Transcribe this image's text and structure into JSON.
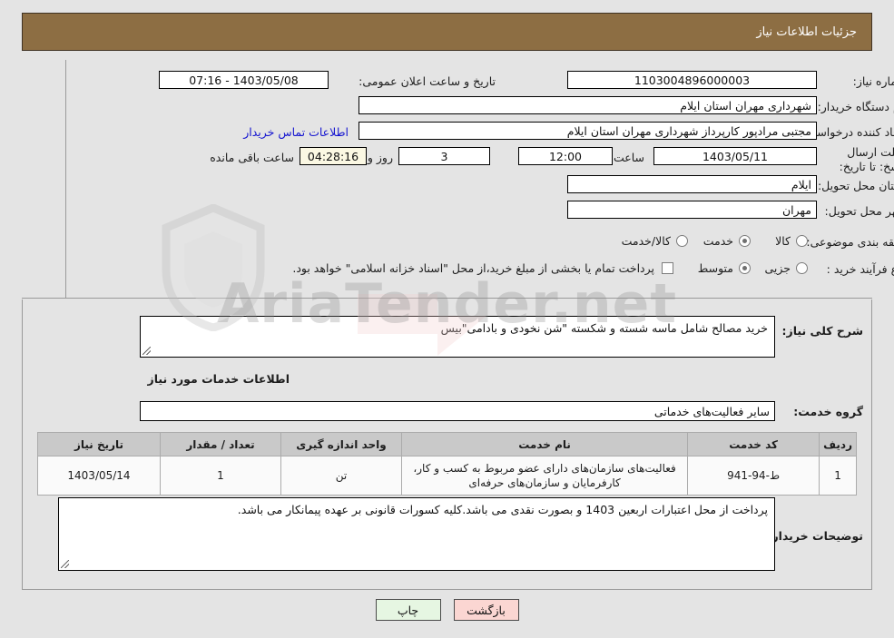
{
  "header": {
    "title": "جزئیات اطلاعات نیاز"
  },
  "watermark": {
    "text": "AriaTender.net"
  },
  "fields": {
    "need_number_label": "شماره نیاز:",
    "need_number_value": "1103004896000003",
    "buyer_org_label": "نام دستگاه خریدار:",
    "buyer_org_value": "شهرداری مهران استان ایلام",
    "creator_label": "ایجاد کننده درخواست:",
    "creator_value": "مجتبی مرادپور کارپرداز شهرداری مهران استان ایلام",
    "deadline_label": "مهلت ارسال پاسخ: تا تاریخ:",
    "deadline_date": "1403/05/11",
    "hour_label": "ساعت",
    "hour_value": "12:00",
    "days_value": "3",
    "days_label": "روز و",
    "countdown_value": "04:28:16",
    "countdown_label": "ساعت باقی مانده",
    "announce_label": "تاریخ و ساعت اعلان عمومی:",
    "announce_value": "1403/05/08 - 07:16",
    "buyer_contact_link": "اطلاعات تماس خریدار",
    "province_label": "استان محل تحویل:",
    "province_value": "ایلام",
    "city_label": "شهر محل تحویل:",
    "city_value": "مهران",
    "category_label": "طبقه بندی موضوعی:",
    "category_options": [
      "کالا",
      "خدمت",
      "کالا/خدمت"
    ],
    "category_selected": "خدمت",
    "process_label": "نوع فرآیند خرید :",
    "process_options": [
      "جزیی",
      "متوسط"
    ],
    "process_selected": "متوسط",
    "treasury_note": "پرداخت تمام یا بخشی از مبلغ خرید،از محل \"اسناد خزانه اسلامی\" خواهد بود.",
    "summary_label": "شرح کلی نیاز:",
    "summary_value": "خرید مصالح شامل ماسه شسته و شکسته \"شن نخودی و بادامی\"بیس",
    "services_heading": "اطلاعات خدمات مورد نیاز",
    "service_group_label": "گروه خدمت:",
    "service_group_value": "سایر فعالیت‌های خدماتی",
    "buyer_notes_label": "توضیحات خریدار:",
    "buyer_notes_value": "پرداخت از محل اعتبارات اربعین 1403 و بصورت نقدی می باشد.کلیه کسورات قانونی بر عهده پیمانکار می باشد."
  },
  "table": {
    "headers": [
      "ردیف",
      "کد خدمت",
      "نام خدمت",
      "واحد اندازه گیری",
      "تعداد / مقدار",
      "تاریخ نیاز"
    ],
    "rows": [
      {
        "row": "1",
        "code": "ط-94-941",
        "name": "فعالیت‌های سازمان‌های دارای عضو مربوط به کسب و کار، کارفرمایان و سازمان‌های حرفه‌ای",
        "unit": "تن",
        "qty": "1",
        "date": "1403/05/14"
      }
    ]
  },
  "buttons": {
    "print": "چاپ",
    "back": "بازگشت"
  },
  "colors": {
    "header_bg": "#8d6e43",
    "page_bg": "#e4e4e4",
    "link": "#1414d0",
    "table_header_bg": "#c9c9c9",
    "countdown_bg": "#fbf8e3",
    "print_btn_bg": "#e6f6e2",
    "back_btn_bg": "#fbd6d2"
  }
}
